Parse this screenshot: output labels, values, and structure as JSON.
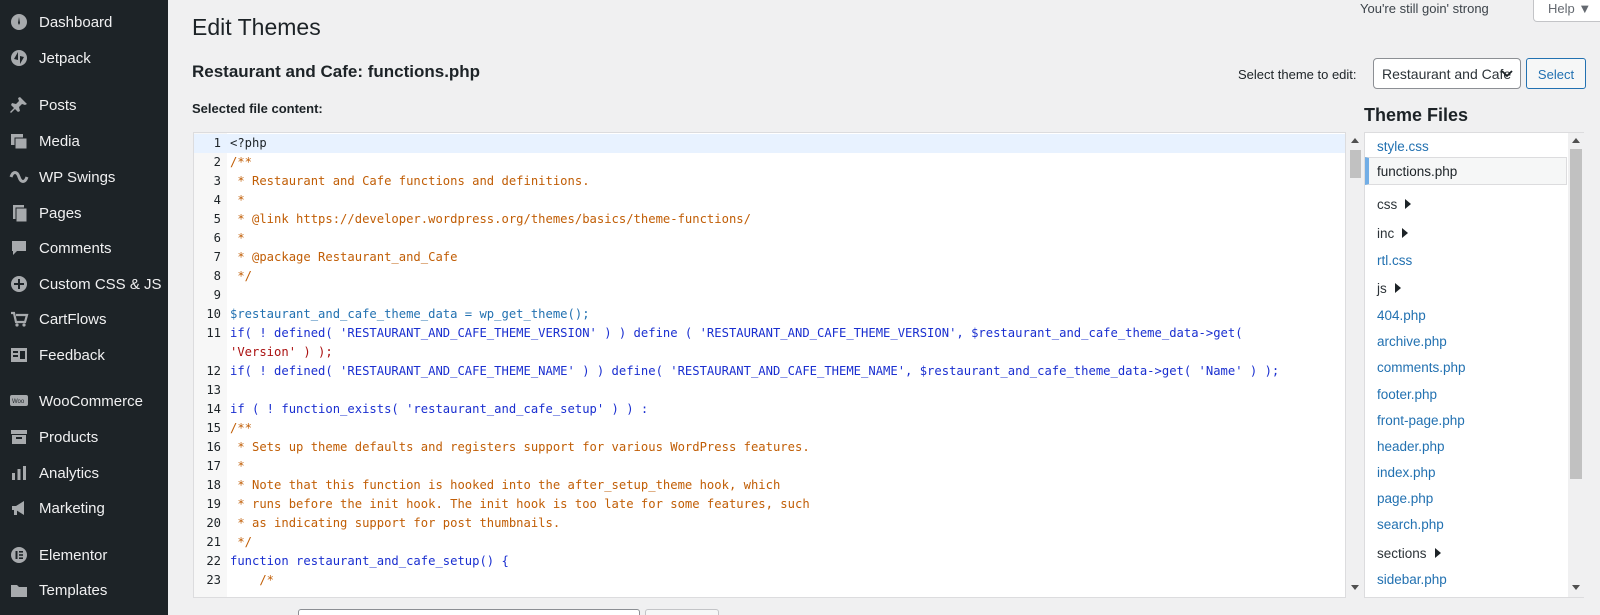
{
  "sidebar": {
    "items": [
      {
        "label": "Dashboard",
        "icon": "dashboard-icon"
      },
      {
        "label": "Jetpack",
        "icon": "jetpack-icon"
      },
      {
        "label": "Posts",
        "icon": "pin-icon"
      },
      {
        "label": "Media",
        "icon": "media-icon"
      },
      {
        "label": "WP Swings",
        "icon": "wp-swings-icon"
      },
      {
        "label": "Pages",
        "icon": "pages-icon"
      },
      {
        "label": "Comments",
        "icon": "comment-icon"
      },
      {
        "label": "Custom CSS & JS",
        "icon": "plus-circle-icon"
      },
      {
        "label": "CartFlows",
        "icon": "cartflows-icon"
      },
      {
        "label": "Feedback",
        "icon": "feedback-icon"
      },
      {
        "label": "WooCommerce",
        "icon": "woo-icon"
      },
      {
        "label": "Products",
        "icon": "archive-icon"
      },
      {
        "label": "Analytics",
        "icon": "bar-chart-icon"
      },
      {
        "label": "Marketing",
        "icon": "megaphone-icon"
      },
      {
        "label": "Elementor",
        "icon": "elementor-icon"
      },
      {
        "label": "Templates",
        "icon": "folder-icon"
      }
    ]
  },
  "header": {
    "title": "Edit Themes",
    "message": "You're still goin' strong",
    "help": "Help ▼"
  },
  "editor_header": {
    "file_title": "Restaurant and Cafe: functions.php",
    "select_label": "Select theme to edit:",
    "selected_theme": "Restaurant and Cafe",
    "select_button": "Select",
    "content_label": "Selected file content:"
  },
  "code": {
    "line_numbers": [
      "1",
      "2",
      "3",
      "4",
      "5",
      "6",
      "7",
      "8",
      "9",
      "10",
      "11",
      "",
      "12",
      "13",
      "14",
      "15",
      "16",
      "17",
      "18",
      "19",
      "20",
      "21",
      "22",
      "23"
    ],
    "lines": [
      "<?php",
      "/**",
      " * Restaurant and Cafe functions and definitions.",
      " *",
      " * @link https://developer.wordpress.org/themes/basics/theme-functions/",
      " *",
      " * @package Restaurant_and_Cafe",
      " */",
      "",
      "$restaurant_and_cafe_theme_data = wp_get_theme();",
      "if( ! defined( 'RESTAURANT_AND_CAFE_THEME_VERSION' ) ) define ( 'RESTAURANT_AND_CAFE_THEME_VERSION', $restaurant_and_cafe_theme_data->get(",
      "'Version' ) );",
      "if( ! defined( 'RESTAURANT_AND_CAFE_THEME_NAME' ) ) define( 'RESTAURANT_AND_CAFE_THEME_NAME', $restaurant_and_cafe_theme_data->get( 'Name' ) );",
      "",
      "if ( ! function_exists( 'restaurant_and_cafe_setup' ) ) :",
      "/**",
      " * Sets up theme defaults and registers support for various WordPress features.",
      " *",
      " * Note that this function is hooked into the after_setup_theme hook, which",
      " * runs before the init hook. The init hook is too late for some features, such",
      " * as indicating support for post thumbnails.",
      " */",
      "function restaurant_and_cafe_setup() {",
      "    /*"
    ]
  },
  "theme_files": {
    "title": "Theme Files",
    "items": [
      {
        "label": "style.css",
        "type": "link"
      },
      {
        "label": "functions.php",
        "type": "active"
      },
      {
        "label": "css",
        "type": "folder"
      },
      {
        "label": "inc",
        "type": "folder"
      },
      {
        "label": "rtl.css",
        "type": "link"
      },
      {
        "label": "js",
        "type": "folder"
      },
      {
        "label": "404.php",
        "type": "link"
      },
      {
        "label": "archive.php",
        "type": "link"
      },
      {
        "label": "comments.php",
        "type": "link"
      },
      {
        "label": "footer.php",
        "type": "link"
      },
      {
        "label": "front-page.php",
        "type": "link"
      },
      {
        "label": "header.php",
        "type": "link"
      },
      {
        "label": "index.php",
        "type": "link"
      },
      {
        "label": "page.php",
        "type": "link"
      },
      {
        "label": "search.php",
        "type": "link"
      },
      {
        "label": "sections",
        "type": "folder"
      },
      {
        "label": "sidebar.php",
        "type": "link"
      }
    ]
  },
  "colors": {
    "sidebar_bg": "#1d2327",
    "link": "#2271b1",
    "comment": "#c15e06",
    "string": "#a11",
    "keyword": "#1a2fd0"
  }
}
